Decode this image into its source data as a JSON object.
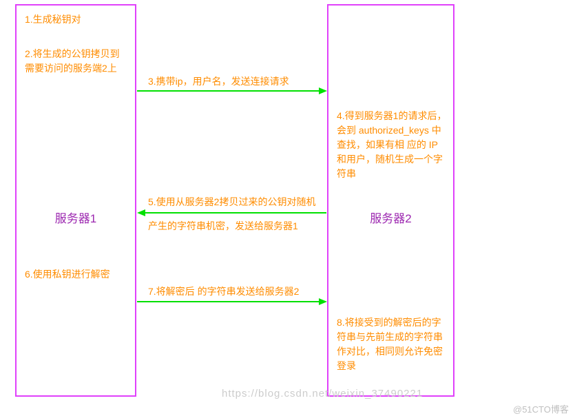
{
  "server1": {
    "title": "服务器1",
    "step1": "1.生成秘钥对",
    "step2": "2.将生成的公钥拷贝到需要访问的服务端2上",
    "step6": "6.使用私钥进行解密"
  },
  "server2": {
    "title": "服务器2",
    "step4": "4.得到服务器1的请求后，会到 authorized_keys 中查找，如果有相 应的 IP 和用户，随机生成一个字符串",
    "step8": "8.将接受到的解密后的字符串与先前生成的字符串作对比，相同则允许免密登录"
  },
  "arrows": {
    "a3": "3.携带ip，用户名，发送连接请求",
    "a5_top": "5.使用从服务器2拷贝过来的公钥对随机",
    "a5_bottom": "产生的字符串机密，发送给服务器1",
    "a7": "7.将解密后 的字符串发送给服务器2"
  },
  "watermark": {
    "csdn": "https://blog.csdn.net/weixin_37490221",
    "cto": "@51CTO博客"
  }
}
